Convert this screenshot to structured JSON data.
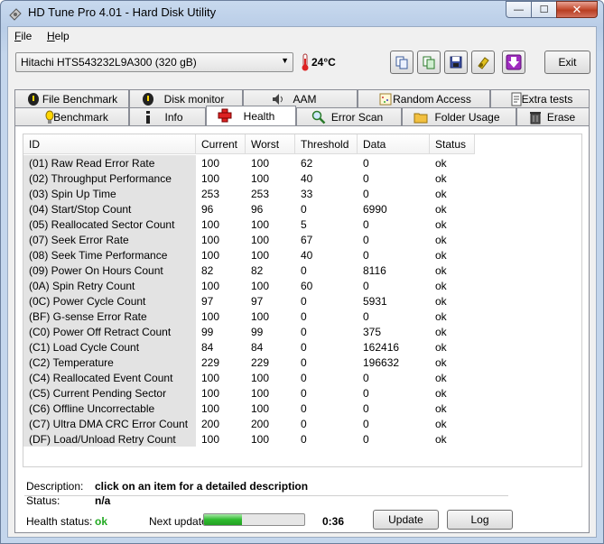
{
  "window": {
    "title": "HD Tune Pro 4.01 - Hard Disk Utility",
    "controls": {
      "minimize": "—",
      "maximize": "☐",
      "close": "✕"
    }
  },
  "menu": [
    {
      "label": "File"
    },
    {
      "label": "Help"
    }
  ],
  "toolbar": {
    "drive": "Hitachi HTS543232L9A300 (320 gB)",
    "temperature": "24°C",
    "icons": [
      "copy-info-icon",
      "copy-screen-icon",
      "save-icon",
      "options-icon",
      "download-icon"
    ],
    "exit_label": "Exit"
  },
  "tabs_top": [
    {
      "label": "File Benchmark",
      "icon": "file-benchmark-icon"
    },
    {
      "label": "Disk monitor",
      "icon": "disk-monitor-icon"
    },
    {
      "label": "AAM",
      "icon": "speaker-icon"
    },
    {
      "label": "Random Access",
      "icon": "random-access-icon"
    },
    {
      "label": "Extra tests",
      "icon": "extra-tests-icon"
    }
  ],
  "tabs_bottom": [
    {
      "label": "Benchmark",
      "icon": "benchmark-icon"
    },
    {
      "label": "Info",
      "icon": "info-icon"
    },
    {
      "label": "Health",
      "icon": "health-cross-icon",
      "active": true
    },
    {
      "label": "Error Scan",
      "icon": "magnifier-icon"
    },
    {
      "label": "Folder Usage",
      "icon": "folder-icon"
    },
    {
      "label": "Erase",
      "icon": "trash-icon"
    }
  ],
  "table": {
    "columns": [
      "ID",
      "Current",
      "Worst",
      "Threshold",
      "Data",
      "Status"
    ],
    "rows": [
      [
        "(01) Raw Read Error Rate",
        "100",
        "100",
        "62",
        "0",
        "ok"
      ],
      [
        "(02) Throughput Performance",
        "100",
        "100",
        "40",
        "0",
        "ok"
      ],
      [
        "(03) Spin Up Time",
        "253",
        "253",
        "33",
        "0",
        "ok"
      ],
      [
        "(04) Start/Stop Count",
        "96",
        "96",
        "0",
        "6990",
        "ok"
      ],
      [
        "(05) Reallocated Sector Count",
        "100",
        "100",
        "5",
        "0",
        "ok"
      ],
      [
        "(07) Seek Error Rate",
        "100",
        "100",
        "67",
        "0",
        "ok"
      ],
      [
        "(08) Seek Time Performance",
        "100",
        "100",
        "40",
        "0",
        "ok"
      ],
      [
        "(09) Power On Hours Count",
        "82",
        "82",
        "0",
        "8116",
        "ok"
      ],
      [
        "(0A) Spin Retry Count",
        "100",
        "100",
        "60",
        "0",
        "ok"
      ],
      [
        "(0C) Power Cycle Count",
        "97",
        "97",
        "0",
        "5931",
        "ok"
      ],
      [
        "(BF) G-sense Error Rate",
        "100",
        "100",
        "0",
        "0",
        "ok"
      ],
      [
        "(C0) Power Off Retract Count",
        "99",
        "99",
        "0",
        "375",
        "ok"
      ],
      [
        "(C1) Load Cycle Count",
        "84",
        "84",
        "0",
        "162416",
        "ok"
      ],
      [
        "(C2) Temperature",
        "229",
        "229",
        "0",
        "196632",
        "ok"
      ],
      [
        "(C4) Reallocated Event Count",
        "100",
        "100",
        "0",
        "0",
        "ok"
      ],
      [
        "(C5) Current Pending Sector",
        "100",
        "100",
        "0",
        "0",
        "ok"
      ],
      [
        "(C6) Offline Uncorrectable",
        "100",
        "100",
        "0",
        "0",
        "ok"
      ],
      [
        "(C7) Ultra DMA CRC Error Count",
        "200",
        "200",
        "0",
        "0",
        "ok"
      ],
      [
        "(DF) Load/Unload Retry Count",
        "100",
        "100",
        "0",
        "0",
        "ok"
      ]
    ]
  },
  "details": {
    "description_label": "Description:",
    "description_value": "click on an item for a detailed description",
    "status_label": "Status:",
    "status_value": "n/a"
  },
  "footer": {
    "health_label": "Health status:",
    "health_value": "ok",
    "health_color": "#22aa22",
    "next_update_label": "Next update:",
    "progress_fraction": 0.38,
    "countdown": "0:36",
    "update_label": "Update",
    "log_label": "Log"
  }
}
